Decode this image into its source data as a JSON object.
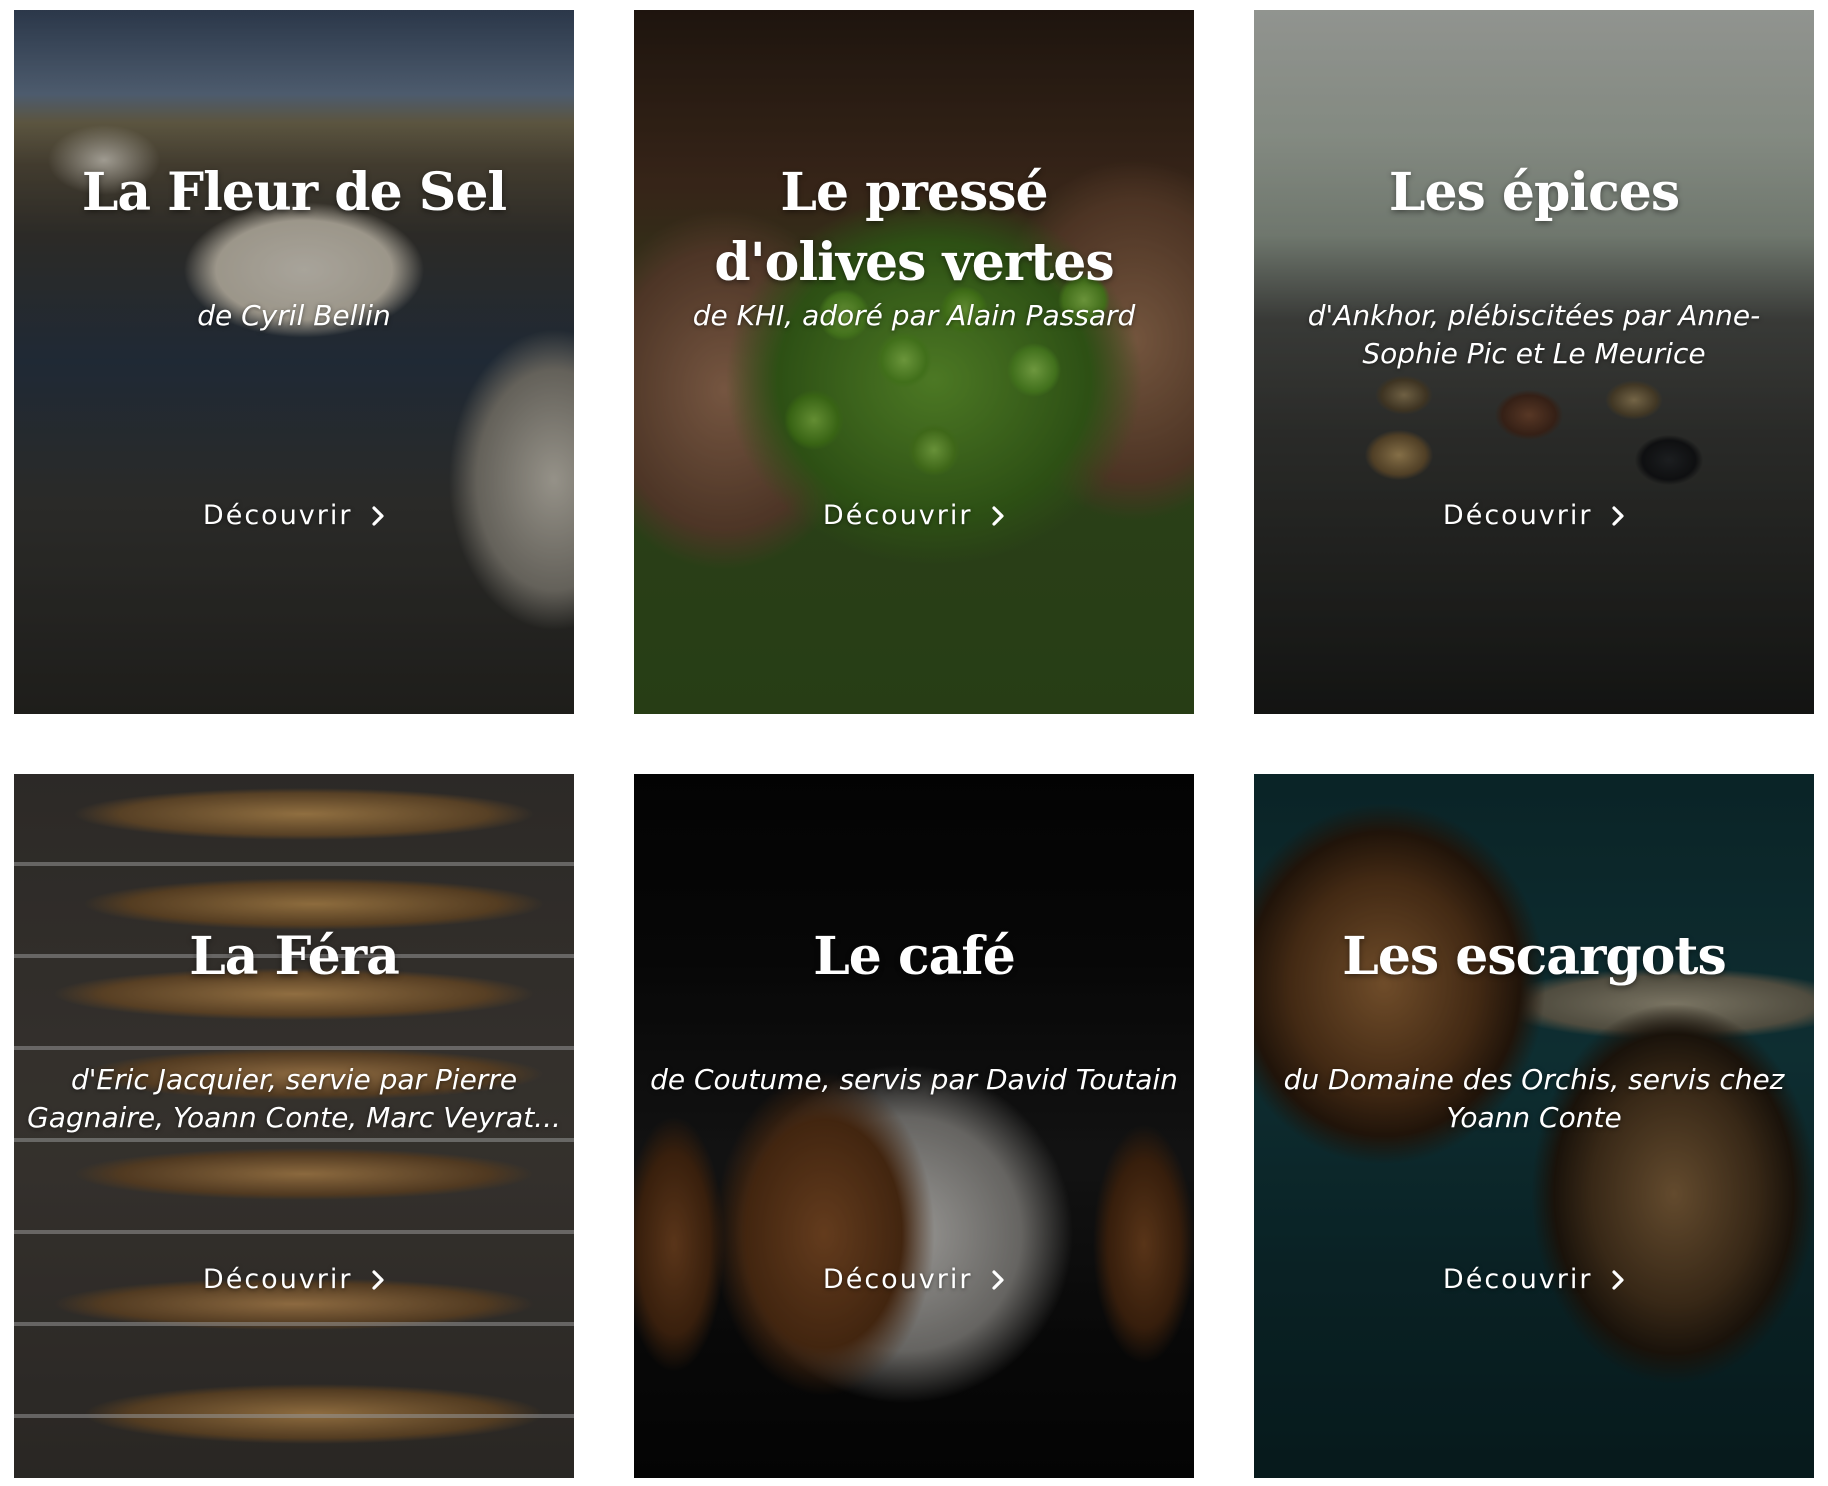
{
  "cards": [
    {
      "title": "La Fleur de Sel",
      "subtitle": "de Cyril Bellin",
      "cta": "Découvrir",
      "image": "salt-marsh-photo"
    },
    {
      "title": "Le pressé d'olives vertes",
      "subtitle": "de KHI, adoré par Alain Passard",
      "cta": "Découvrir",
      "image": "green-olives-in-hands-photo"
    },
    {
      "title": "Les épices",
      "subtitle": "d'Ankhor, plébiscitées par Anne-Sophie Pic et Le Meurice",
      "cta": "Découvrir",
      "image": "spice-tins-on-wood-photo"
    },
    {
      "title": "La Féra",
      "subtitle": "d'Eric Jacquier, servie par Pierre Gagnaire, Yoann Conte, Marc Veyrat...",
      "cta": "Découvrir",
      "image": "smoked-fish-racks-photo"
    },
    {
      "title": "Le café",
      "subtitle": "de Coutume, servis par David Toutain",
      "cta": "Découvrir",
      "image": "coffee-bean-bags-photo"
    },
    {
      "title": "Les escargots",
      "subtitle": "du Domaine des Orchis, servis chez Yoann Conte",
      "cta": "Découvrir",
      "image": "snails-photo"
    }
  ],
  "icons": {
    "cta_arrow": "chevron-right-icon"
  },
  "colors": {
    "overlay_text": "#ffffff",
    "background": "#ffffff"
  }
}
